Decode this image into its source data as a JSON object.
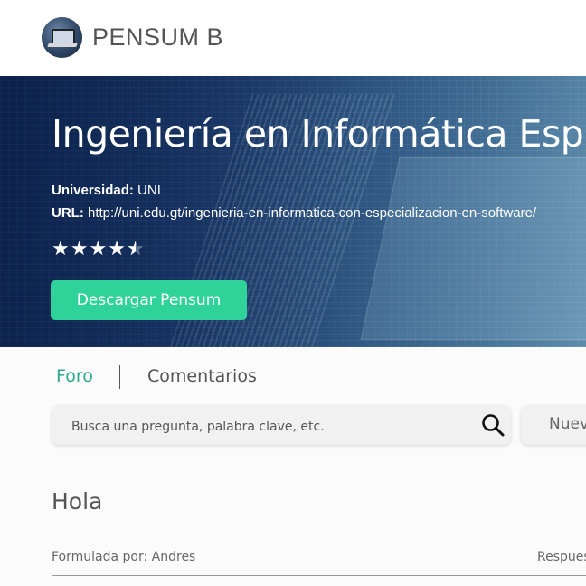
{
  "header": {
    "brand": "PENSUM B",
    "logo_icon": "laptop-logo-icon"
  },
  "hero": {
    "title": "Ingeniería en Informática Esp. Software",
    "university_label": "Universidad:",
    "university_value": "UNI",
    "url_label": "URL:",
    "url_value": "http://uni.edu.gt/ingenieria-en-informatica-con-especializacion-en-software/",
    "rating": 4.5,
    "rating_max": 5,
    "download_label": "Descargar Pensum"
  },
  "tabs": [
    {
      "label": "Foro",
      "active": true
    },
    {
      "label": "Comentarios",
      "active": false
    }
  ],
  "search": {
    "placeholder": "Busca una pregunta, palabra clave, etc.",
    "icon": "search-icon",
    "new_label": "Nueva"
  },
  "question": {
    "title": "Hola",
    "author": "Formulada por: Andres",
    "replies": "Respuestas"
  },
  "colors": {
    "accent": "#2aa98b",
    "button": "#2fd39a",
    "hero_dark": "#0d2552"
  }
}
